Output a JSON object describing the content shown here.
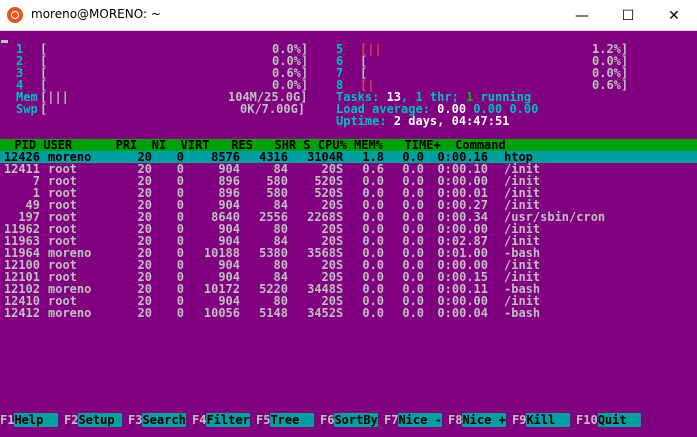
{
  "window": {
    "title": "moreno@MORENO: ~",
    "minimize": "—",
    "maximize": "☐",
    "close": "✕"
  },
  "meters": {
    "left": [
      {
        "num": "1",
        "bar": "[",
        "pct": "0.0%]"
      },
      {
        "num": "2",
        "bar": "[",
        "pct": "0.0%]"
      },
      {
        "num": "3",
        "bar": "[",
        "pct": "0.6%]"
      },
      {
        "num": "4",
        "bar": "[",
        "pct": "0.0%]"
      }
    ],
    "right": [
      {
        "num": "5",
        "bar": "[||",
        "pct": "1.2%]"
      },
      {
        "num": "6",
        "bar": "[",
        "pct": "0.0%]"
      },
      {
        "num": "7",
        "bar": "[",
        "pct": "0.0%]"
      },
      {
        "num": "8",
        "bar": "[|",
        "pct": "0.6%]"
      }
    ],
    "mem": {
      "label": "Mem",
      "bar": "[|||",
      "value": "104M/25.0G]"
    },
    "swp": {
      "label": "Swp",
      "bar": "[",
      "value": "0K/7.00G]"
    }
  },
  "summary": {
    "tasks_label": "Tasks: ",
    "tasks": "13",
    "thr_label": ", 1 thr; ",
    "running": "1",
    "running_label": " running",
    "load_label": "Load average: ",
    "load1": "0.00",
    "load5": "0.00",
    "load15": "0.00",
    "uptime_label": "Uptime: ",
    "uptime": "2 days, 04:47:51"
  },
  "table": {
    "header": "  PID USER      PRI  NI  VIRT   RES   SHR S CPU% MEM%   TIME+  Command",
    "rows": [
      {
        "pid": "12426",
        "user": "moreno",
        "pri": "20",
        "ni": "0",
        "virt": "8576",
        "res": "4316",
        "shr": "3104",
        "s": "R",
        "cpu": "1.8",
        "mem": "0.0",
        "time": "0:00.16",
        "cmd": "htop"
      },
      {
        "pid": "12411",
        "user": "root",
        "pri": "20",
        "ni": "0",
        "virt": "904",
        "res": "84",
        "shr": "20",
        "s": "S",
        "cpu": "0.6",
        "mem": "0.0",
        "time": "0:00.10",
        "cmd": "/init"
      },
      {
        "pid": "7",
        "user": "root",
        "pri": "20",
        "ni": "0",
        "virt": "896",
        "res": "580",
        "shr": "520",
        "s": "S",
        "cpu": "0.0",
        "mem": "0.0",
        "time": "0:00.00",
        "cmd": "/init"
      },
      {
        "pid": "1",
        "user": "root",
        "pri": "20",
        "ni": "0",
        "virt": "896",
        "res": "580",
        "shr": "520",
        "s": "S",
        "cpu": "0.0",
        "mem": "0.0",
        "time": "0:00.01",
        "cmd": "/init"
      },
      {
        "pid": "49",
        "user": "root",
        "pri": "20",
        "ni": "0",
        "virt": "904",
        "res": "84",
        "shr": "20",
        "s": "S",
        "cpu": "0.0",
        "mem": "0.0",
        "time": "0:00.27",
        "cmd": "/init"
      },
      {
        "pid": "197",
        "user": "root",
        "pri": "20",
        "ni": "0",
        "virt": "8640",
        "res": "2556",
        "shr": "2268",
        "s": "S",
        "cpu": "0.0",
        "mem": "0.0",
        "time": "0:00.34",
        "cmd": "/usr/sbin/cron"
      },
      {
        "pid": "11962",
        "user": "root",
        "pri": "20",
        "ni": "0",
        "virt": "904",
        "res": "80",
        "shr": "20",
        "s": "S",
        "cpu": "0.0",
        "mem": "0.0",
        "time": "0:00.00",
        "cmd": "/init"
      },
      {
        "pid": "11963",
        "user": "root",
        "pri": "20",
        "ni": "0",
        "virt": "904",
        "res": "84",
        "shr": "20",
        "s": "S",
        "cpu": "0.0",
        "mem": "0.0",
        "time": "0:02.87",
        "cmd": "/init"
      },
      {
        "pid": "11964",
        "user": "moreno",
        "pri": "20",
        "ni": "0",
        "virt": "10188",
        "res": "5380",
        "shr": "3568",
        "s": "S",
        "cpu": "0.0",
        "mem": "0.0",
        "time": "0:01.00",
        "cmd": "-bash"
      },
      {
        "pid": "12100",
        "user": "root",
        "pri": "20",
        "ni": "0",
        "virt": "904",
        "res": "80",
        "shr": "20",
        "s": "S",
        "cpu": "0.0",
        "mem": "0.0",
        "time": "0:00.00",
        "cmd": "/init"
      },
      {
        "pid": "12101",
        "user": "root",
        "pri": "20",
        "ni": "0",
        "virt": "904",
        "res": "84",
        "shr": "20",
        "s": "S",
        "cpu": "0.0",
        "mem": "0.0",
        "time": "0:00.15",
        "cmd": "/init"
      },
      {
        "pid": "12102",
        "user": "moreno",
        "pri": "20",
        "ni": "0",
        "virt": "10172",
        "res": "5220",
        "shr": "3448",
        "s": "S",
        "cpu": "0.0",
        "mem": "0.0",
        "time": "0:00.11",
        "cmd": "-bash"
      },
      {
        "pid": "12410",
        "user": "root",
        "pri": "20",
        "ni": "0",
        "virt": "904",
        "res": "80",
        "shr": "20",
        "s": "S",
        "cpu": "0.0",
        "mem": "0.0",
        "time": "0:00.00",
        "cmd": "/init"
      },
      {
        "pid": "12412",
        "user": "moreno",
        "pri": "20",
        "ni": "0",
        "virt": "10056",
        "res": "5148",
        "shr": "3452",
        "s": "S",
        "cpu": "0.0",
        "mem": "0.0",
        "time": "0:00.04",
        "cmd": "-bash"
      }
    ]
  },
  "footer": [
    {
      "key": "F1",
      "label": "Help  "
    },
    {
      "key": "F2",
      "label": "Setup "
    },
    {
      "key": "F3",
      "label": "Search"
    },
    {
      "key": "F4",
      "label": "Filter"
    },
    {
      "key": "F5",
      "label": "Tree  "
    },
    {
      "key": "F6",
      "label": "SortBy"
    },
    {
      "key": "F7",
      "label": "Nice -"
    },
    {
      "key": "F8",
      "label": "Nice +"
    },
    {
      "key": "F9",
      "label": "Kill  "
    },
    {
      "key": "F10",
      "label": "Quit  "
    }
  ],
  "colors": {
    "background": "#800080",
    "header_bar": "#00a000",
    "selection": "#00a0a0"
  }
}
